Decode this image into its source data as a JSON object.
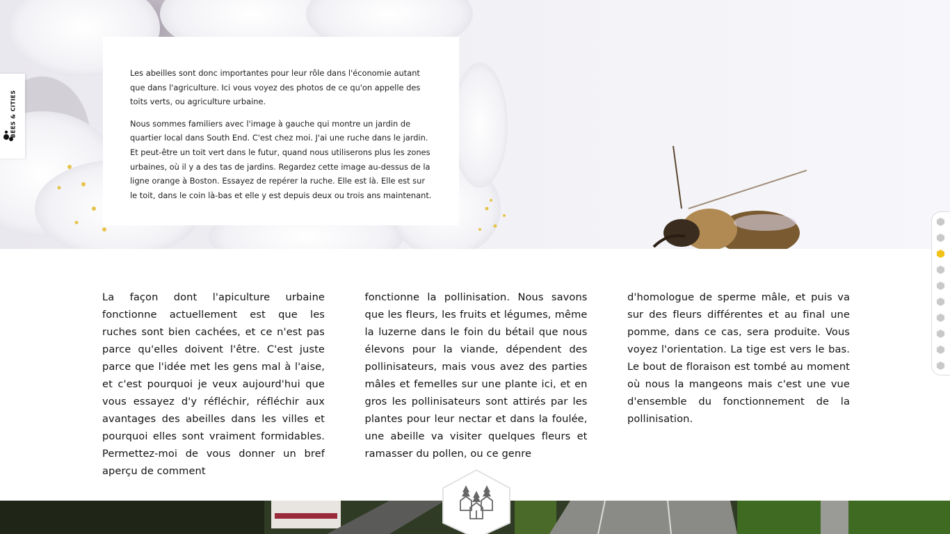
{
  "brand": {
    "name": "BEES & CITIES"
  },
  "intro": {
    "paragraphs": [
      "Les abeilles sont donc importantes pour leur rôle dans l'économie autant que dans l'agriculture. Ici vous voyez des photos de ce qu'on appelle des toits verts, ou agriculture urbaine.",
      "Nous sommes familiers avec l'image à gauche qui montre un jardin de quartier local dans South End. C'est chez moi. J'ai une ruche dans le jardin. Et peut-être un toit vert dans le futur, quand nous utiliserons plus les zones urbaines, où il y a des tas de jardins. Regardez cette image au-dessus de la ligne orange à Boston. Essayez de repérer la ruche. Elle est là. Elle est sur le toit, dans le coin là-bas et elle y est depuis deux ou trois ans maintenant."
    ]
  },
  "article": {
    "columns": [
      "La façon dont l'apiculture urbaine fonctionne actuellement est que les ruches sont bien cachées, et ce n'est pas parce qu'elles doivent l'être. C'est juste parce que l'idée met les gens mal à l'aise, et c'est pourquoi je veux aujourd'hui que vous essayez d'y réfléchir, réfléchir aux avantages des abeilles dans les villes et pourquoi elles sont vraiment formidables. Permettez-moi de vous donner un bref aperçu de comment",
      "fonctionne la pollinisation. Nous savons que les fleurs, les fruits et légumes, même la luzerne dans le foin du bétail que nous élevons pour la viande, dépendent des pollinisateurs, mais vous avez des parties mâles et femelles sur une plante ici, et en gros les pollinisateurs sont attirés par les plantes pour leur nectar et dans la foulée, une abeille va visiter quelques fleurs et ramasser du pollen, ou ce genre",
      "d'homologue de sperme mâle, et puis va sur des fleurs différentes et au final une pomme, dans ce cas, sera produite. Vous voyez l'orientation. La tige est vers le bas. Le bout de floraison est tombé au moment où nous la mangeons mais c'est une vue d'ensemble du fonctionnement de la pollinisation."
    ]
  },
  "nav": {
    "total": 10,
    "active_index": 2,
    "active_color": "#f2c21b",
    "inactive_color": "#c9c9c9"
  },
  "icons": {
    "brand_logo": "honeycomb-dots-icon",
    "section_badge": "houses-and-trees-icon"
  }
}
